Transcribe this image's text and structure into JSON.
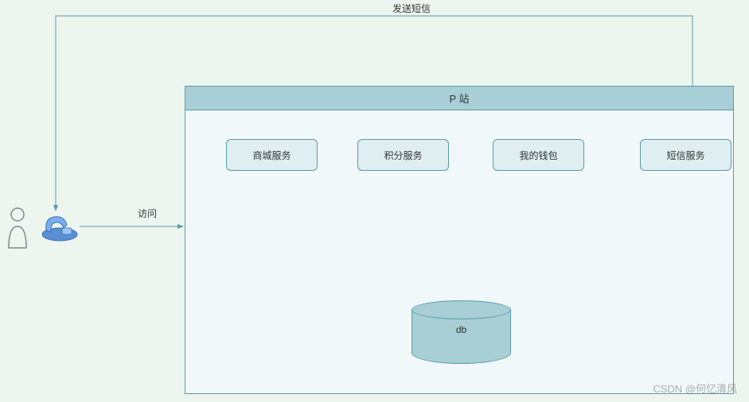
{
  "labels": {
    "top": "发送短信",
    "left": "访问"
  },
  "container": {
    "title": "P 站"
  },
  "services": {
    "s1": "商城服务",
    "s2": "积分服务",
    "s3": "我的钱包",
    "s4": "短信服务"
  },
  "db": {
    "label": "db"
  },
  "watermark": "CSDN @何忆清风"
}
